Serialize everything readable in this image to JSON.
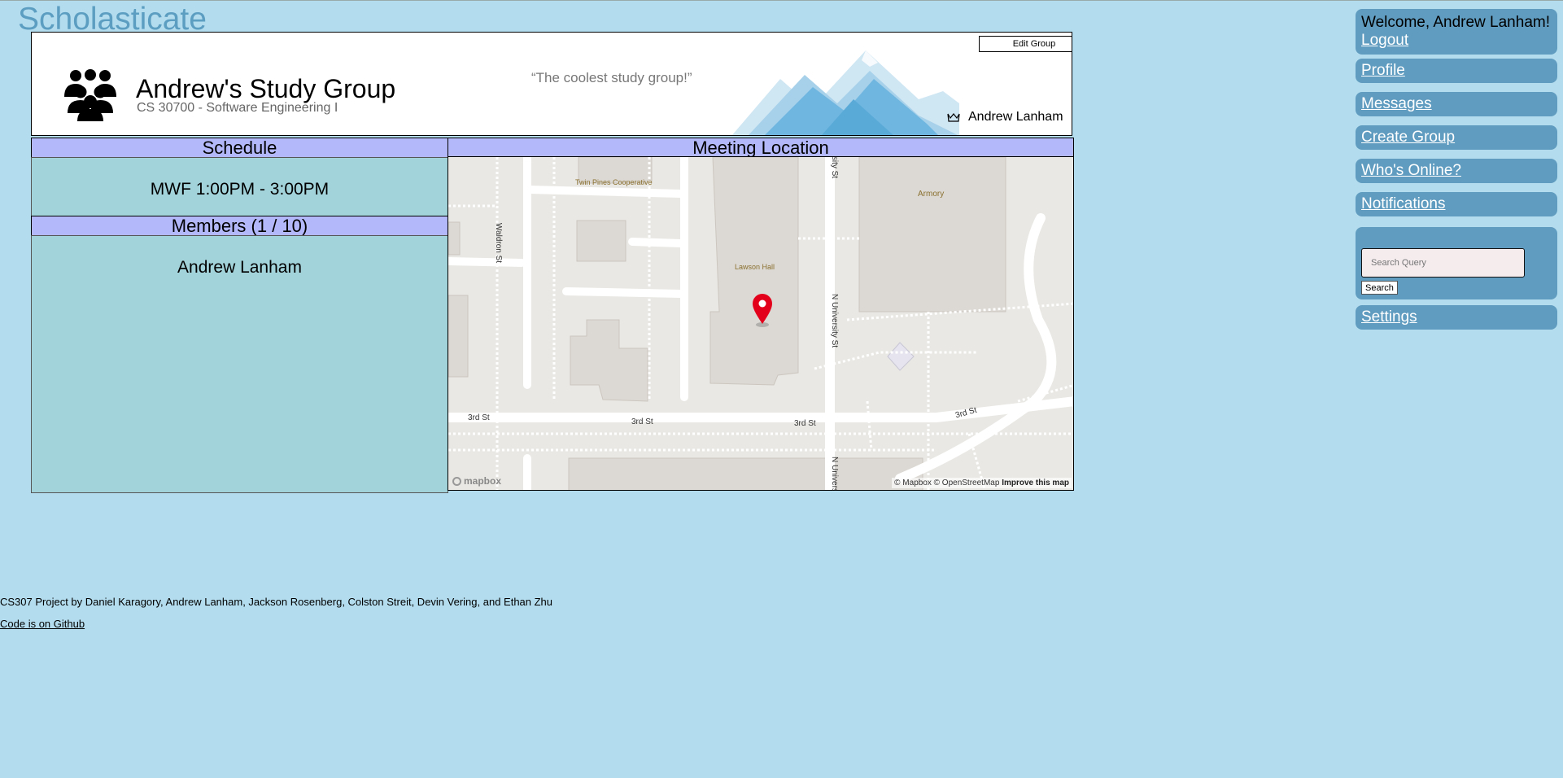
{
  "brand": "Scholasticate",
  "group": {
    "name": "Andrew's Study Group",
    "course": "CS 30700 - Software Engineering I",
    "tagline": "“The coolest study group!”",
    "owner": "Andrew Lanham",
    "edit_label": "Edit Group"
  },
  "schedule": {
    "heading": "Schedule",
    "time": "MWF 1:00PM - 3:00PM"
  },
  "members": {
    "heading": "Members (1 / 10)",
    "list": [
      "Andrew Lanham"
    ]
  },
  "location": {
    "heading": "Meeting Location",
    "map": {
      "labels": {
        "twin_pines": "Twin Pines Cooperative",
        "armory": "Armory",
        "lawson": "Lawson Hall",
        "waldron": "Waldron St",
        "n_university_top": "N University St",
        "n_university_mid": "N University St",
        "n_university_bottom": "N University St",
        "third_1": "3rd St",
        "third_2": "3rd St",
        "third_3": "3rd St",
        "third_4": "3rd St"
      },
      "logo": "mapbox",
      "attribution": "© Mapbox © OpenStreetMap",
      "improve": "Improve this map"
    }
  },
  "footer": {
    "credits": "CS307 Project by Daniel Karagory, Andrew Lanham, Jackson Rosenberg, Colston Streit, Devin Vering, and Ethan Zhu",
    "github": "Code is on Github"
  },
  "sidebar": {
    "welcome": "Welcome, Andrew Lanham!",
    "logout": "Logout",
    "links": {
      "profile": "Profile",
      "messages": "Messages",
      "create_group": "Create Group",
      "whos_online": "Who's Online?",
      "notifications": "Notifications",
      "settings": "Settings"
    },
    "search": {
      "placeholder": "Search Query",
      "button": "Search"
    }
  },
  "colors": {
    "background": "#b3ddee",
    "panel_header": "#b3b8fa",
    "panel_body": "#a2d2da",
    "sidebar": "#609cbf",
    "brand": "#5c9dc2",
    "pin": "#e3001b"
  }
}
